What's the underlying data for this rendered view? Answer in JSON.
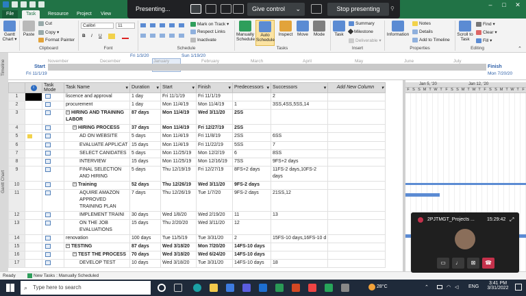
{
  "ribbon_tabs": [
    "File",
    "Task",
    "Resource",
    "Project",
    "View"
  ],
  "presenting": {
    "label": "Presenting...",
    "give_control": "Give control",
    "stop": "Stop presenting"
  },
  "ribbon": {
    "view": {
      "gantt": "Gantt",
      "chart": "Chart ▾"
    },
    "clipboard": {
      "paste": "Paste",
      "cut": "Cut",
      "copy": "Copy ▾",
      "format_painter": "Format Painter",
      "group": "Clipboard"
    },
    "font": {
      "family": "Calibri",
      "size": "11",
      "group": "Font"
    },
    "schedule": {
      "mark_on_track": "Mark on Track ▾",
      "respect_links": "Respect Links",
      "inactivate": "Inactivate",
      "group": "Schedule"
    },
    "tasks": {
      "manually": "Manually Schedule",
      "auto": "Auto Schedule",
      "inspect": "Inspect",
      "move": "Move",
      "mode": "Mode",
      "group": "Tasks"
    },
    "insert": {
      "task": "Task",
      "summary": "Summary",
      "milestone": "Milestone",
      "deliverable": "Deliverable ▾",
      "group": "Insert"
    },
    "properties": {
      "information": "Information",
      "notes": "Notes",
      "details": "Details",
      "add_timeline": "Add to Timeline",
      "group": "Properties"
    },
    "editing": {
      "scroll": "Scroll to Task",
      "find": "Find ▾",
      "clear": "Clear ▾",
      "fill": "Fill ▾",
      "group": "Editing"
    }
  },
  "timeline": {
    "side_label": "Timeline",
    "start_label": "Start",
    "start_date": "Fri 11/1/19",
    "finish_label": "Finish",
    "finish_date": "Mon 7/20/20",
    "callout_start": "Fri 1/3/20",
    "callout_end": "Sun 1/19/20",
    "months": [
      "November",
      "December",
      "January",
      "February",
      "March",
      "April",
      "May",
      "June",
      "July"
    ]
  },
  "grid": {
    "side_label": "Gantt Chart",
    "columns": [
      "Task Mode",
      "Task Name",
      "Duration",
      "Start",
      "Finish",
      "Predecessors",
      "Successors",
      "Add New Column"
    ],
    "rows": [
      {
        "id": "1",
        "name": "liscence and approval",
        "dur": "1 day",
        "start": "Fri 11/1/19",
        "finish": "Fri 11/1/19",
        "pred": "",
        "succ": "2"
      },
      {
        "id": "2",
        "name": "procurement",
        "dur": "1 day",
        "start": "Mon 11/4/19",
        "finish": "Mon 11/4/19",
        "pred": "1",
        "succ": "3SS,4SS,5SS,14"
      },
      {
        "id": "3",
        "name": "HIRING AND TRAINING LABOR",
        "dur": "87 days",
        "start": "Mon 11/4/19",
        "finish": "Wed 3/11/20",
        "pred": "2SS",
        "succ": ""
      },
      {
        "id": "4",
        "name": "HIRING PROCESS",
        "dur": "37 days",
        "start": "Mon 11/4/19",
        "finish": "Fri 12/27/19",
        "pred": "2SS",
        "succ": ""
      },
      {
        "id": "5",
        "name": "AD ON WEBSITE",
        "dur": "5 days",
        "start": "Mon 11/4/19",
        "finish": "Fri 11/8/19",
        "pred": "2SS",
        "succ": "6SS"
      },
      {
        "id": "6",
        "name": "EVALUATE APPLICAT",
        "dur": "15 days",
        "start": "Mon 11/4/19",
        "finish": "Fri 11/22/19",
        "pred": "5SS",
        "succ": "7"
      },
      {
        "id": "7",
        "name": "SELECT CANIDATES",
        "dur": "5 days",
        "start": "Mon 11/25/19",
        "finish": "Mon 12/2/19",
        "pred": "6",
        "succ": "8SS"
      },
      {
        "id": "8",
        "name": "INTERVIEW",
        "dur": "15 days",
        "start": "Mon 11/25/19",
        "finish": "Mon 12/16/19",
        "pred": "7SS",
        "succ": "9FS+2 days"
      },
      {
        "id": "9",
        "name": "FINAL SELECTION AND HIRING",
        "dur": "5 days",
        "start": "Thu 12/19/19",
        "finish": "Fri 12/27/19",
        "pred": "8FS+2 days",
        "succ": "11FS-2 days,10FS-2 days"
      },
      {
        "id": "10",
        "name": "Training",
        "dur": "52 days",
        "start": "Thu 12/26/19",
        "finish": "Wed 3/11/20",
        "pred": "9FS-2 days",
        "succ": ""
      },
      {
        "id": "11",
        "name": "AQUIRE AMAZON APPROVED TRAINING PLAN",
        "dur": "7 days",
        "start": "Thu 12/26/19",
        "finish": "Tue 1/7/20",
        "pred": "9FS-2 days",
        "succ": "21SS,12"
      },
      {
        "id": "12",
        "name": "IMPLEMENT TRAINI",
        "dur": "30 days",
        "start": "Wed 1/8/20",
        "finish": "Wed 2/19/20",
        "pred": "11",
        "succ": "13"
      },
      {
        "id": "13",
        "name": "ON THE JOB EVALUATIONS",
        "dur": "15 days",
        "start": "Thu 2/20/20",
        "finish": "Wed 3/11/20",
        "pred": "12",
        "succ": ""
      },
      {
        "id": "14",
        "name": "renovation",
        "dur": "100 days",
        "start": "Tue 11/5/19",
        "finish": "Tue 3/31/20",
        "pred": "2",
        "succ": "15FS-10 days,16FS-10 d"
      },
      {
        "id": "15",
        "name": "TESTING",
        "dur": "87 days",
        "start": "Wed 3/18/20",
        "finish": "Mon 7/20/20",
        "pred": "14FS-10 days",
        "succ": ""
      },
      {
        "id": "16",
        "name": "TEST THE PROCESS",
        "dur": "70 days",
        "start": "Wed 3/18/20",
        "finish": "Wed 6/24/20",
        "pred": "14FS-10 days",
        "succ": ""
      },
      {
        "id": "17",
        "name": "DEVELOP TEST",
        "dur": "10 days",
        "start": "Wed 3/18/20",
        "finish": "Tue 3/31/20",
        "pred": "14FS-10 days",
        "succ": "18"
      }
    ]
  },
  "gantt": {
    "week1": "Jan 5, '20",
    "week2": "Jan 12, '20",
    "days": [
      "F",
      "S",
      "S",
      "M",
      "T",
      "W",
      "T",
      "F",
      "S",
      "S",
      "M",
      "T",
      "W",
      "T",
      "F",
      "S",
      "S",
      "M",
      "T",
      "W",
      "T",
      "F"
    ]
  },
  "statusbar": {
    "ready": "Ready",
    "new_tasks": "New Tasks : Manually Scheduled"
  },
  "taskbar": {
    "search": "Type here to search",
    "temp": "28°C",
    "lang": "ENG",
    "time": "3:41 PM",
    "date": "3/31/2022"
  },
  "call": {
    "name": "2PJTMGT_Projects ...",
    "time": "15:29:42"
  },
  "colors": {
    "accent": "#217346",
    "gantt_bar": "#5b8bd3",
    "call_red": "#c4314b"
  }
}
